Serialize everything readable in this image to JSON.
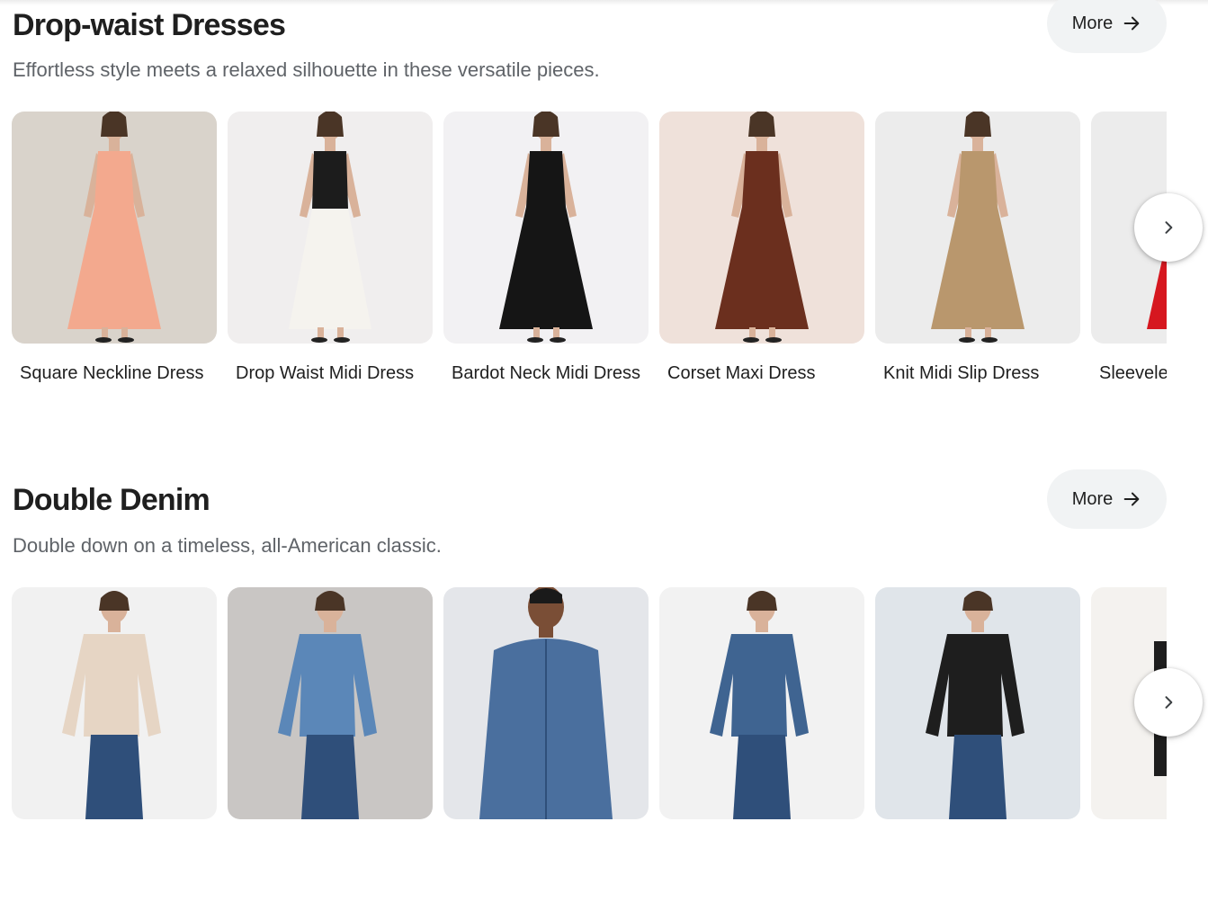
{
  "sections": [
    {
      "title": "Drop-waist Dresses",
      "subtitle": "Effortless style meets a relaxed silhouette in these versatile pieces.",
      "more_label": "More",
      "items": [
        {
          "label": "Square Neckline Dress",
          "bg": "#d9d3cb",
          "garment": "#f3a98e"
        },
        {
          "label": "Drop Waist Midi Dress",
          "bg": "#f0eeee",
          "garment": "#f5f3ee"
        },
        {
          "label": "Bardot Neck Midi Dress",
          "bg": "#f2f1f3",
          "garment": "#151515"
        },
        {
          "label": "Corset Maxi Dress",
          "bg": "#efe1da",
          "garment": "#6b2f1e"
        },
        {
          "label": "Knit Midi Slip Dress",
          "bg": "#ececec",
          "garment": "#b9976d"
        },
        {
          "label": "Sleeveless Dress",
          "bg": "#ececec",
          "garment": "#d6171f"
        }
      ]
    },
    {
      "title": "Double Denim",
      "subtitle": "Double down on a timeless, all-American classic.",
      "more_label": "More",
      "items": [
        {
          "label": "",
          "bg": "#f1f1f1",
          "garment": "#e6d5c4"
        },
        {
          "label": "",
          "bg": "#c9c6c4",
          "garment": "#5b87b8"
        },
        {
          "label": "",
          "bg": "#e4e6ea",
          "garment": "#4a6f9e"
        },
        {
          "label": "",
          "bg": "#f2f2f2",
          "garment": "#3f6491"
        },
        {
          "label": "",
          "bg": "#e0e5ea",
          "garment": "#1e1e1e"
        },
        {
          "label": "",
          "bg": "#f4f2ef",
          "garment": "#1e1e1e"
        }
      ]
    }
  ],
  "icons": {
    "more_arrow": "arrow-right-icon",
    "next": "chevron-right-icon"
  }
}
